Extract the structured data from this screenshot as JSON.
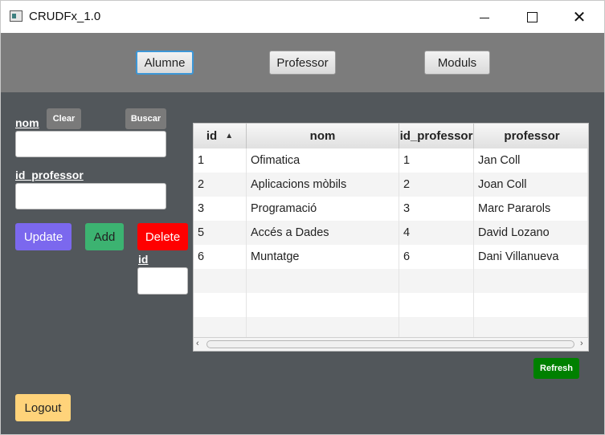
{
  "window": {
    "title": "CRUDFx_1.0"
  },
  "nav": {
    "alumne": "Alumne",
    "professor": "Professor",
    "moduls": "Moduls"
  },
  "form": {
    "nom_label": "nom",
    "clear_label": "Clear",
    "buscar_label": "Buscar",
    "nom_value": "",
    "id_professor_label": "id_professor",
    "id_professor_value": "",
    "update_label": "Update",
    "add_label": "Add",
    "delete_label": "Delete",
    "id_label": "id",
    "id_value": ""
  },
  "table": {
    "columns": [
      "id",
      "nom",
      "id_professor",
      "professor"
    ],
    "sort_column": "id",
    "sort_direction": "ascending",
    "rows": [
      [
        "1",
        "Ofimatica",
        "1",
        "Jan Coll"
      ],
      [
        "2",
        "Aplicacions mòbils",
        "2",
        "Joan Coll"
      ],
      [
        "3",
        "Programació",
        "3",
        "Marc Pararols"
      ],
      [
        "5",
        "Accés a Dades",
        "4",
        "David Lozano"
      ],
      [
        "6",
        "Muntatge",
        "6",
        "Dani Villanueva"
      ],
      [
        "",
        "",
        "",
        ""
      ],
      [
        "",
        "",
        "",
        ""
      ],
      [
        "",
        "",
        "",
        ""
      ]
    ]
  },
  "refresh_label": "Refresh",
  "logout_label": "Logout",
  "colors": {
    "update": "#7b68ee",
    "add": "#3cb371",
    "delete": "#ff0000",
    "refresh": "#008000",
    "logout": "#ffd37a"
  }
}
